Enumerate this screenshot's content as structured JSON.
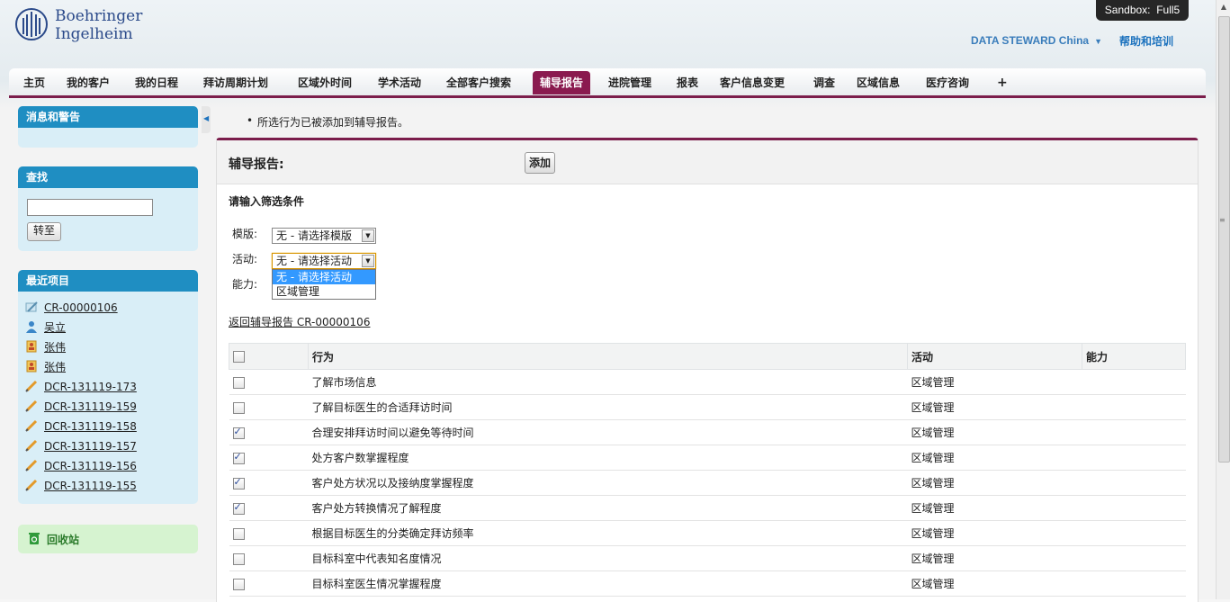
{
  "header": {
    "brand_line1": "Boehringer",
    "brand_line2": "Ingelheim",
    "sandbox_label": "Sandbox:",
    "sandbox_name": "Full5",
    "user_menu": "DATA STEWARD China",
    "help_link": "帮助和培训"
  },
  "tabs": [
    {
      "label": "主页"
    },
    {
      "label": "我的客户"
    },
    {
      "label": "我的日程"
    },
    {
      "label": "拜访周期计划"
    },
    {
      "label": "区域外时间"
    },
    {
      "label": "学术活动"
    },
    {
      "label": "全部客户搜索"
    },
    {
      "label": "辅导报告"
    },
    {
      "label": "进院管理"
    },
    {
      "label": "报表"
    },
    {
      "label": "客户信息变更"
    },
    {
      "label": "调查"
    },
    {
      "label": "区域信息"
    },
    {
      "label": "医疗咨询"
    },
    {
      "label": "+"
    }
  ],
  "sidebar": {
    "messages_title": "消息和警告",
    "find_title": "查找",
    "find_input_value": "",
    "go_button": "转至",
    "recent_title": "最近项目",
    "recent_items": [
      {
        "label": "CR-00000106",
        "icon": "pen-document-icon"
      },
      {
        "label": "吴立",
        "icon": "user-icon"
      },
      {
        "label": "张伟",
        "icon": "contact-card-icon"
      },
      {
        "label": "张伟",
        "icon": "contact-card-icon"
      },
      {
        "label": "DCR-131119-173",
        "icon": "pencil-icon"
      },
      {
        "label": "DCR-131119-159",
        "icon": "pencil-icon"
      },
      {
        "label": "DCR-131119-158",
        "icon": "pencil-icon"
      },
      {
        "label": "DCR-131119-157",
        "icon": "pencil-icon"
      },
      {
        "label": "DCR-131119-156",
        "icon": "pencil-icon"
      },
      {
        "label": "DCR-131119-155",
        "icon": "pencil-icon"
      }
    ],
    "recycle_bin": "回收站"
  },
  "main": {
    "message": "所选行为已被添加到辅导报告。",
    "panel_title": "辅导报告:",
    "add_button": "添加",
    "filter_title": "请输入筛选条件",
    "template_label": "模版:",
    "template_value": "无 - 请选择模版",
    "activity_label": "活动:",
    "activity_value": "无 - 请选择活动",
    "ability_label": "能力:",
    "activity_options": [
      "无 - 请选择活动",
      "区域管理"
    ],
    "back_link": "返回辅导报告 CR-00000106",
    "columns": {
      "behavior": "行为",
      "activity": "活动",
      "ability": "能力"
    },
    "rows": [
      {
        "behavior": "了解市场信息",
        "activity": "区域管理",
        "ability": "",
        "checked": false
      },
      {
        "behavior": "了解目标医生的合适拜访时间",
        "activity": "区域管理",
        "ability": "",
        "checked": false
      },
      {
        "behavior": "合理安排拜访时间以避免等待时间",
        "activity": "区域管理",
        "ability": "",
        "checked": true
      },
      {
        "behavior": "处方客户数掌握程度",
        "activity": "区域管理",
        "ability": "",
        "checked": true
      },
      {
        "behavior": "客户处方状况以及接纳度掌握程度",
        "activity": "区域管理",
        "ability": "",
        "checked": true
      },
      {
        "behavior": "客户处方转换情况了解程度",
        "activity": "区域管理",
        "ability": "",
        "checked": true
      },
      {
        "behavior": "根据目标医生的分类确定拜访频率",
        "activity": "区域管理",
        "ability": "",
        "checked": false
      },
      {
        "behavior": "目标科室中代表知名度情况",
        "activity": "区域管理",
        "ability": "",
        "checked": false
      },
      {
        "behavior": "目标科室医生情况掌握程度",
        "activity": "区域管理",
        "ability": "",
        "checked": false
      }
    ]
  },
  "colors": {
    "accent": "#8a1a4f",
    "sidebar_header": "#1f8ec2",
    "sidebar_body": "#d9eef7",
    "link": "#1e73be"
  }
}
